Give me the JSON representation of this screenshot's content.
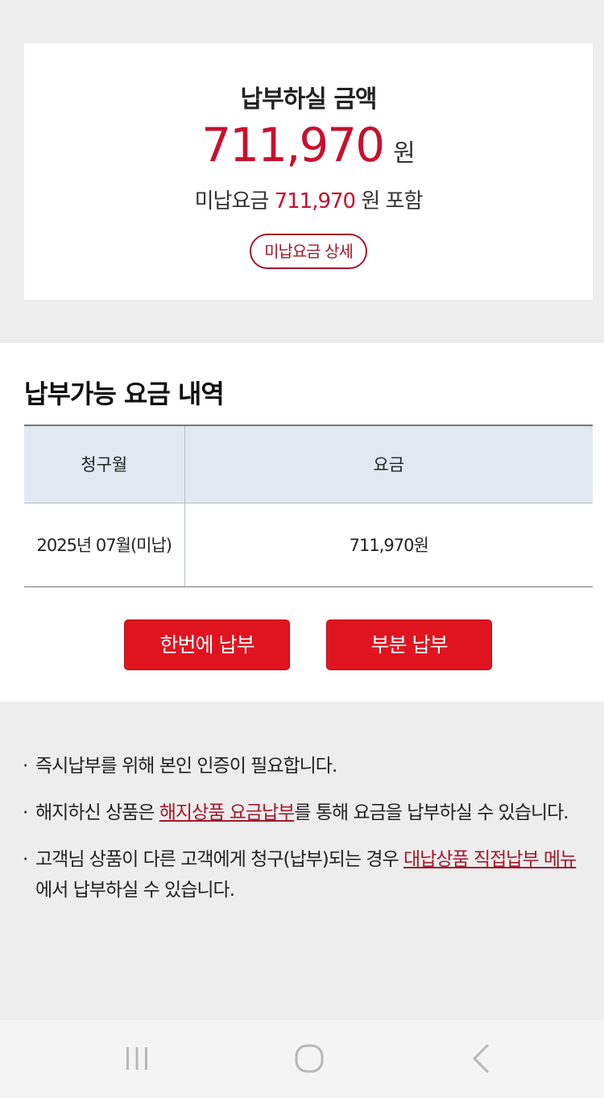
{
  "summary": {
    "title": "납부하실 금액",
    "amount": "711,970",
    "unit": "원",
    "unpaid_prefix": "미납요금",
    "unpaid_amount": "711,970",
    "unpaid_suffix": "원 포함",
    "detail_button": "미납요금 상세"
  },
  "bills": {
    "title": "납부가능 요금 내역",
    "headers": [
      "청구월",
      "요금"
    ],
    "rows": [
      {
        "month": "2025년 07월(미납)",
        "amount": "711,970원"
      }
    ],
    "pay_full_button": "한번에 납부",
    "pay_partial_button": "부분 납부"
  },
  "notes": [
    {
      "bullet": "·",
      "text": "즉시납부를 위해 본인 인증이 필요합니다."
    },
    {
      "bullet": "·",
      "before": "해지하신 상품은 ",
      "link": "해지상품 요금납부",
      "after": "를 통해 요금을 납부하실 수 있습니다."
    },
    {
      "bullet": "·",
      "before": "고객님 상품이 다른 고객에게 청구(납부)되는 경우 ",
      "link": "대납상품 직접납부 메뉴",
      "after": "에서 납부하실 수 있습니다."
    }
  ],
  "navbar": {
    "icons": [
      "recent-apps-icon",
      "home-icon",
      "back-icon"
    ]
  },
  "colors": {
    "accent": "#c8102e",
    "button": "#e0141f",
    "link": "#a4182c",
    "table_header": "#e1e8f1",
    "background": "#ededed"
  }
}
